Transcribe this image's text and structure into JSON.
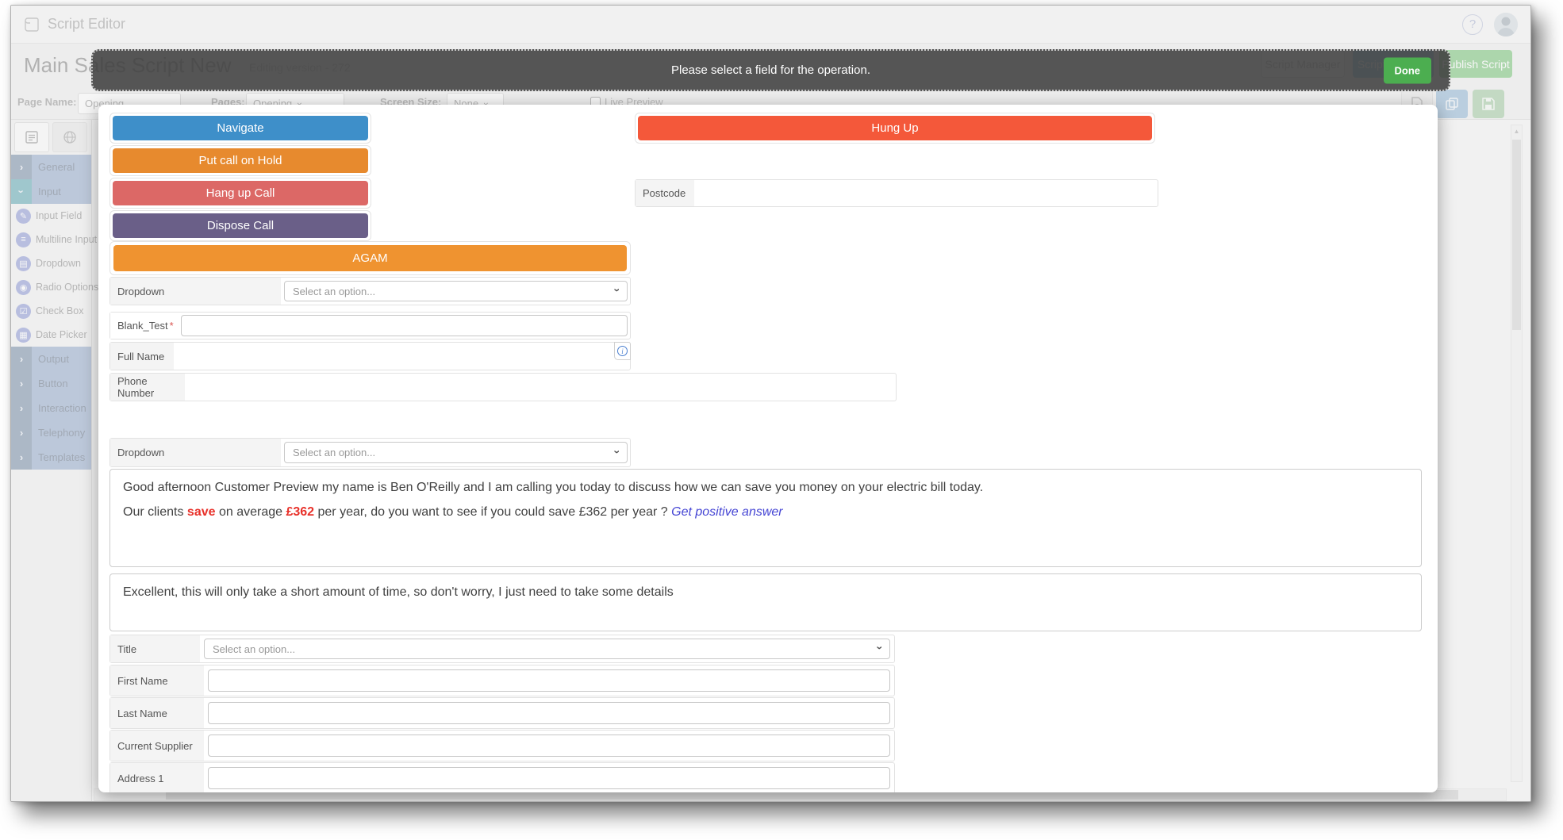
{
  "window": {
    "app_title": "Script Editor",
    "help_icon": "?",
    "page_title": "Main Sales Script New",
    "version_label": "Editing version - 272",
    "header_buttons": {
      "script_manager": "Script Manager",
      "script_settings": "Script Settings",
      "publish": "Publish Script"
    },
    "toolbar": {
      "page_name_label": "Page Name:",
      "page_name_value": "Opening",
      "pages_label": "Pages:",
      "pages_value": "Opening",
      "screen_size_label": "Screen Size:",
      "screen_size_value": "None",
      "live_preview_label": "Live Preview"
    }
  },
  "sidebar": {
    "items": [
      {
        "label": "General",
        "type": "group"
      },
      {
        "label": "Input",
        "type": "group-expanded"
      },
      {
        "label": "Input Field",
        "type": "tool",
        "glyph": "✎"
      },
      {
        "label": "Multiline Input",
        "type": "tool",
        "glyph": "≡"
      },
      {
        "label": "Dropdown",
        "type": "tool",
        "glyph": "▤"
      },
      {
        "label": "Radio Options",
        "type": "tool",
        "glyph": "◉"
      },
      {
        "label": "Check Box",
        "type": "tool",
        "glyph": "☑"
      },
      {
        "label": "Date Picker",
        "type": "tool",
        "glyph": "▦"
      }
    ],
    "groups_after": [
      {
        "label": "Output"
      },
      {
        "label": "Button"
      },
      {
        "label": "Interaction"
      },
      {
        "label": "Telephony"
      },
      {
        "label": "Templates"
      }
    ]
  },
  "modal": {
    "message": "Please select a field for the operation.",
    "done_label": "Done",
    "call_buttons": {
      "navigate": "Navigate",
      "hold": "Put call on Hold",
      "hangup": "Hang up Call",
      "dispose": "Dispose Call",
      "agam": "AGAM",
      "hung_up": "Hung Up"
    },
    "fields": {
      "postcode": "Postcode",
      "dropdown1": "Dropdown",
      "dropdown_placeholder": "Select an option...",
      "blank_test": "Blank_Test",
      "required_mark": "*",
      "full_name": "Full Name",
      "phone": "Phone Number",
      "dropdown2": "Dropdown",
      "title": "Title",
      "title_placeholder": "Select an option...",
      "first_name": "First Name",
      "last_name": "Last Name",
      "current_supplier": "Current Supplier",
      "address1": "Address 1",
      "info_icon": "i"
    },
    "script": {
      "p1": "Good afternoon Customer Preview my name is Ben O'Reilly and I am calling you today to discuss how we can save you money on your electric bill today.",
      "p2_a": "Our clients ",
      "p2_save": "save",
      "p2_b": " on average ",
      "p2_amount": "£362",
      "p2_c": " per year, do you want to see if you could save £362 per year ?  ",
      "p2_link": "Get positive answer",
      "p3": "Excellent, this will only take a short amount of time, so don't worry, I just need to take some details"
    }
  },
  "icons": {
    "chevron": "›",
    "select_chevron": "›",
    "scroll_up": "▲"
  },
  "colors": {
    "navigate": "#3e8fc9",
    "hold": "#e78a2e",
    "hangup": "#dc6866",
    "dispose": "#6a5f88",
    "agam": "#ef9330",
    "hung_up": "#f4583a",
    "done": "#4cae50",
    "publish": "#5cb85c",
    "settings": "#4aa3d8",
    "link": "#4545d4",
    "save_red": "#e8312a",
    "required": "#d9534f",
    "modal_header": "#3e3e3e"
  }
}
